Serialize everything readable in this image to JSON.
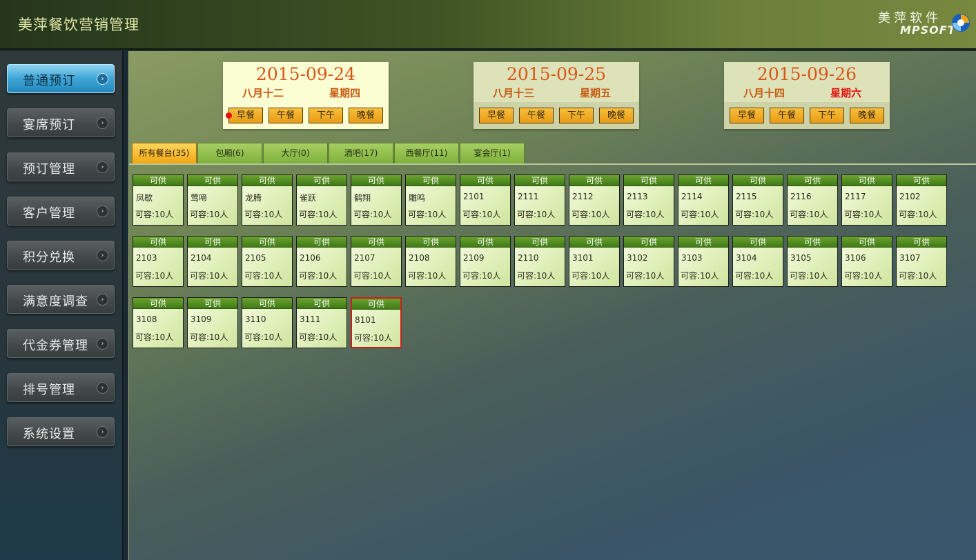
{
  "app": {
    "title": "美萍餐饮营销管理"
  },
  "logo": {
    "cn": "美萍软件",
    "en": "MPSOFT"
  },
  "sidebar": {
    "items": [
      {
        "label": "普通预订",
        "active": true
      },
      {
        "label": "宴席预订"
      },
      {
        "label": "预订管理"
      },
      {
        "label": "客户管理"
      },
      {
        "label": "积分兑换"
      },
      {
        "label": "满意度调查"
      },
      {
        "label": "代金券管理"
      },
      {
        "label": "排号管理"
      },
      {
        "label": "系统设置"
      }
    ],
    "arrow": "›"
  },
  "dates": [
    {
      "date": "2015-09-24",
      "lunar": "八月十二",
      "weekday": "星期四",
      "active": true,
      "meals": [
        "早餐",
        "午餐",
        "下午",
        "晚餐"
      ]
    },
    {
      "date": "2015-09-25",
      "lunar": "八月十三",
      "weekday": "星期五",
      "meals": [
        "早餐",
        "午餐",
        "下午",
        "晚餐"
      ]
    },
    {
      "date": "2015-09-26",
      "lunar": "八月十四",
      "weekday": "星期六",
      "weekend": true,
      "meals": [
        "早餐",
        "午餐",
        "下午",
        "晚餐"
      ]
    }
  ],
  "tabs": [
    {
      "label": "所有餐台(35)",
      "active": true
    },
    {
      "label": "包厢(6)"
    },
    {
      "label": "大厅(0)"
    },
    {
      "label": "酒吧(17)"
    },
    {
      "label": "西餐厅(11)"
    },
    {
      "label": "宴会厅(1)"
    }
  ],
  "tables": {
    "status": "可供",
    "capacity": "可容:10人",
    "items": [
      "凤歇",
      "莺啼",
      "龙腾",
      "雀跃",
      "鹤翔",
      "雕鸣",
      "2101",
      "2111",
      "2112",
      "2113",
      "2114",
      "2115",
      "2116",
      "2117",
      "2102",
      "2103",
      "2104",
      "2105",
      "2106",
      "2107",
      "2108",
      "2109",
      "2110",
      "3101",
      "3102",
      "3103",
      "3104",
      "3105",
      "3106",
      "3107",
      "3108",
      "3109",
      "3110",
      "3111",
      "8101"
    ],
    "selected": "8101"
  },
  "colors": {
    "accent": "#d9561a",
    "weekend": "#e3150e",
    "status_green": "#4f8a1f",
    "meal_orange": "#f0a82a"
  }
}
